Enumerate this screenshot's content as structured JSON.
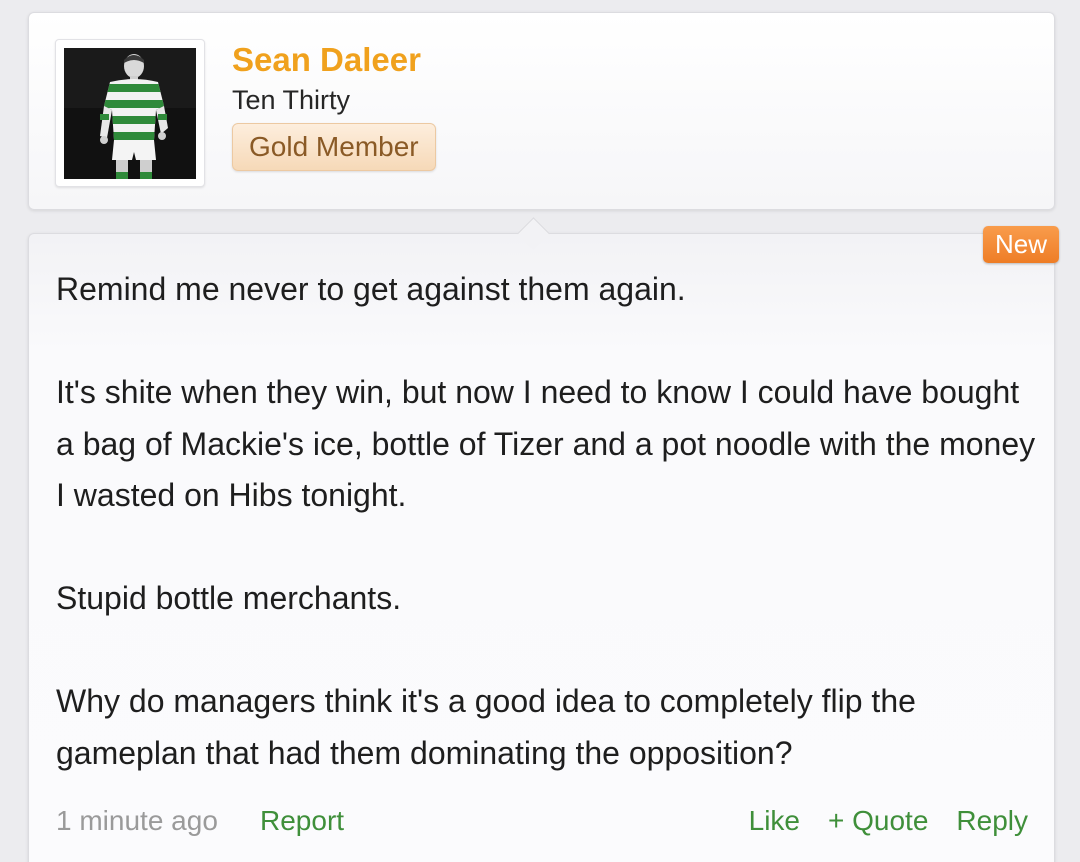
{
  "user": {
    "name": "Sean Daleer",
    "title": "Ten Thirty",
    "badge": "Gold Member",
    "avatar_alt": "avatar"
  },
  "post": {
    "new_badge": "New",
    "paragraphs": [
      "Remind me never to get against them again.",
      "It's shite when they win, but now I need to know I could have bought a bag of Mackie's ice, bottle of Tizer and a pot noodle with the money I wasted on Hibs tonight.",
      "Stupid bottle merchants.",
      "Why do managers think it's a good idea to completely flip the gameplan that had them dominating the opposition?"
    ],
    "timestamp": "1 minute ago",
    "report_label": "Report",
    "actions": {
      "like": "Like",
      "quote": "+ Quote",
      "reply": "Reply"
    }
  },
  "colors": {
    "username": "#f0a11d",
    "link": "#3f8f3a",
    "new_badge": "#ee7d26",
    "badge_text": "#8a5a26"
  }
}
